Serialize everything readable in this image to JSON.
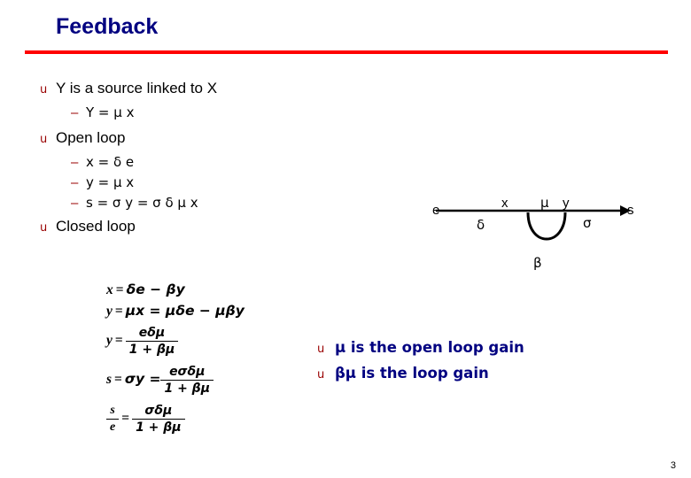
{
  "slide": {
    "title": "Feedback",
    "page_number": "3",
    "accent_rule_color": "#ff0000",
    "title_color": "#000080",
    "bullet_color": "#990000"
  },
  "bullets": [
    {
      "marker": "u",
      "text": "Y is a source linked to X",
      "subs": [
        {
          "dash": "–",
          "text": "Y = μ x"
        }
      ]
    },
    {
      "marker": "u",
      "text": "Open loop",
      "subs": [
        {
          "dash": "–",
          "text": "x = δ e"
        },
        {
          "dash": "–",
          "text": "y = μ x"
        },
        {
          "dash": "–",
          "text": "s = σ y = σ δ μ x"
        }
      ]
    },
    {
      "marker": "u",
      "text": "Closed loop",
      "subs": []
    }
  ],
  "equations": [
    {
      "lhs": "x",
      "rhs": "δe − βy"
    },
    {
      "lhs": "y",
      "rhs": "μx = μδe − μβy"
    },
    {
      "lhs": "y",
      "rhs_num": "eδμ",
      "rhs_den": "1 + βμ"
    },
    {
      "lhs": "s",
      "rhs": "σy =",
      "rhs_num": "eσδμ",
      "rhs_den": "1 + βμ"
    },
    {
      "lhs_num": "s",
      "lhs_den": "e",
      "rhs_num": "σδμ",
      "rhs_den": "1 + βμ"
    }
  ],
  "diagram": {
    "input_label": "e",
    "node1_label": "x",
    "node2_label": "y",
    "output_label": "s",
    "gain_delta": "δ",
    "gain_mu": "μ",
    "gain_sigma": "σ",
    "feedback_beta": "β"
  },
  "notes": [
    {
      "marker": "u",
      "text": "μ is the open loop gain"
    },
    {
      "marker": "u",
      "text": "βμ is the loop gain"
    }
  ]
}
